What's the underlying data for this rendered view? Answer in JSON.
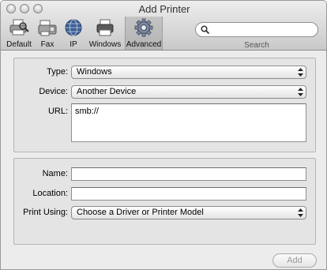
{
  "window": {
    "title": "Add Printer"
  },
  "toolbar": {
    "items": [
      {
        "label": "Default",
        "icon": "default-printer-icon"
      },
      {
        "label": "Fax",
        "icon": "fax-icon"
      },
      {
        "label": "IP",
        "icon": "globe-icon"
      },
      {
        "label": "Windows",
        "icon": "windows-printer-icon"
      },
      {
        "label": "Advanced",
        "icon": "gear-icon",
        "selected": true
      }
    ],
    "search": {
      "value": "",
      "placeholder": "",
      "label": "Search"
    }
  },
  "connection": {
    "type_label": "Type:",
    "type_value": "Windows",
    "device_label": "Device:",
    "device_value": "Another Device",
    "url_label": "URL:",
    "url_value": "smb://"
  },
  "details": {
    "name_label": "Name:",
    "name_value": "",
    "location_label": "Location:",
    "location_value": "",
    "print_using_label": "Print Using:",
    "print_using_value": "Choose a Driver or Printer Model"
  },
  "footer": {
    "add_label": "Add",
    "add_enabled": false
  }
}
